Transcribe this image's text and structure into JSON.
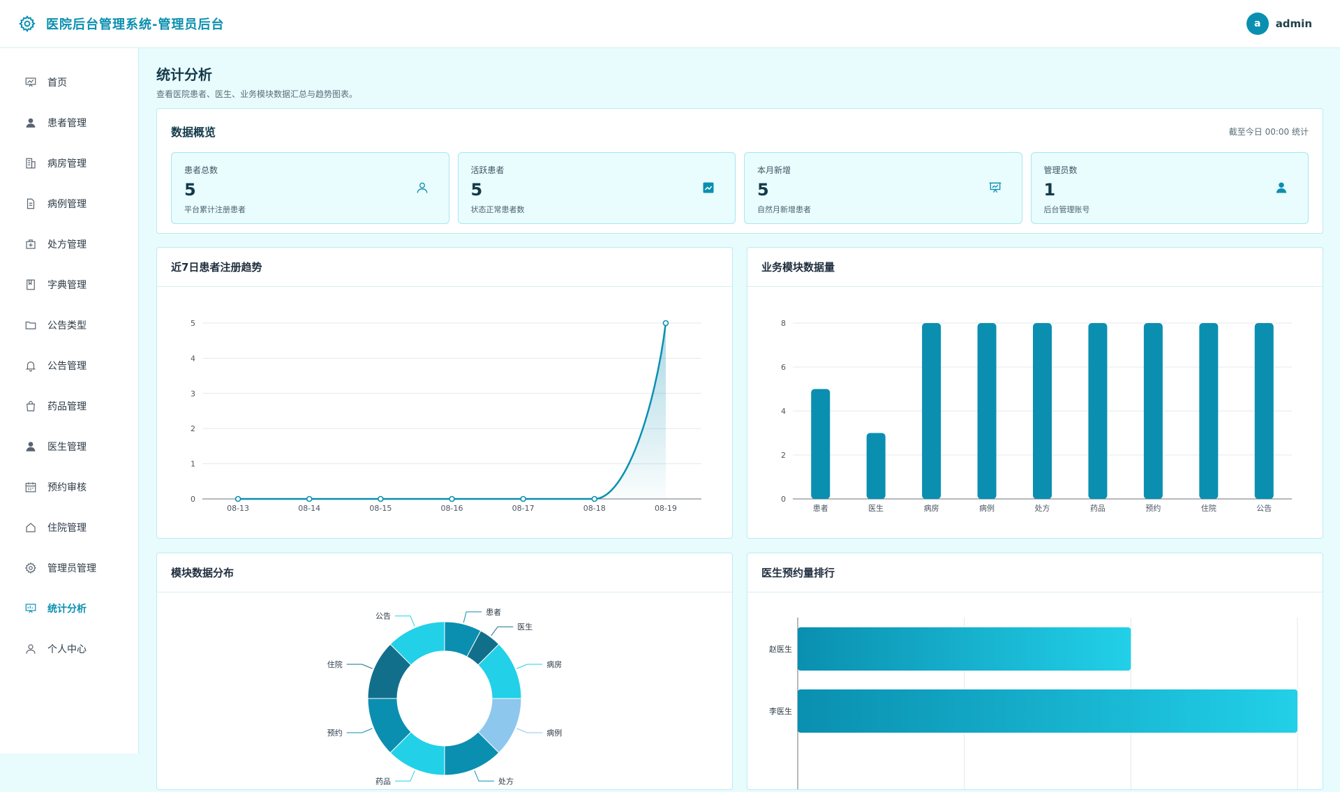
{
  "header": {
    "title": "医院后台管理系统-管理员后台",
    "avatar_letter": "a",
    "username": "admin"
  },
  "sidebar": {
    "items": [
      {
        "label": "首页",
        "icon": "chart-board-icon"
      },
      {
        "label": "患者管理",
        "icon": "user-icon"
      },
      {
        "label": "病房管理",
        "icon": "building-icon"
      },
      {
        "label": "病例管理",
        "icon": "document-icon"
      },
      {
        "label": "处方管理",
        "icon": "medical-kit-icon"
      },
      {
        "label": "字典管理",
        "icon": "book-icon"
      },
      {
        "label": "公告类型",
        "icon": "folder-icon"
      },
      {
        "label": "公告管理",
        "icon": "bell-icon"
      },
      {
        "label": "药品管理",
        "icon": "bag-icon"
      },
      {
        "label": "医生管理",
        "icon": "doctor-icon"
      },
      {
        "label": "预约审核",
        "icon": "calendar-icon"
      },
      {
        "label": "住院管理",
        "icon": "home-icon"
      },
      {
        "label": "管理员管理",
        "icon": "gear-icon"
      },
      {
        "label": "统计分析",
        "icon": "analytics-icon",
        "active": true
      },
      {
        "label": "个人中心",
        "icon": "person-icon"
      }
    ]
  },
  "page": {
    "title": "统计分析",
    "subtitle": "查看医院患者、医生、业务模块数据汇总与趋势图表。"
  },
  "overview": {
    "title": "数据概览",
    "note": "截至今日 00:00 统计",
    "stats": [
      {
        "label": "患者总数",
        "value": "5",
        "desc": "平台累计注册患者",
        "icon": "user-outline-icon"
      },
      {
        "label": "活跃患者",
        "value": "5",
        "desc": "状态正常患者数",
        "icon": "trend-icon"
      },
      {
        "label": "本月新增",
        "value": "5",
        "desc": "自然月新增患者",
        "icon": "presentation-icon"
      },
      {
        "label": "管理员数",
        "value": "1",
        "desc": "后台管理账号",
        "icon": "admin-user-icon"
      }
    ]
  },
  "panels": {
    "trend_title": "近7日患者注册趋势",
    "modules_title": "业务模块数据量",
    "distribution_title": "模块数据分布",
    "ranking_title": "医生预约量排行"
  },
  "colors": {
    "accent": "#0a8fb0",
    "light": "#22d0e8",
    "bg": "#e8fbfd"
  },
  "chart_data": [
    {
      "type": "line",
      "title": "近7日患者注册趋势",
      "x": [
        "08-13",
        "08-14",
        "08-15",
        "08-16",
        "08-17",
        "08-18",
        "08-19"
      ],
      "values": [
        0,
        0,
        0,
        0,
        0,
        0,
        5
      ],
      "ylim": [
        0,
        5
      ],
      "yticks": [
        0,
        1,
        2,
        3,
        4,
        5
      ],
      "grid": true
    },
    {
      "type": "bar",
      "title": "业务模块数据量",
      "categories": [
        "患者",
        "医生",
        "病房",
        "病例",
        "处方",
        "药品",
        "预约",
        "住院",
        "公告"
      ],
      "values": [
        5,
        3,
        8,
        8,
        8,
        8,
        8,
        8,
        8
      ],
      "ylim": [
        0,
        8
      ],
      "yticks": [
        0,
        2,
        4,
        6,
        8
      ],
      "grid": true
    },
    {
      "type": "pie",
      "title": "模块数据分布",
      "categories": [
        "患者",
        "医生",
        "病房",
        "病例",
        "处方",
        "药品",
        "预约",
        "住院",
        "公告"
      ],
      "values": [
        5,
        3,
        8,
        8,
        8,
        8,
        8,
        8,
        8
      ],
      "colors": [
        "#0a8fb0",
        "#126f8c",
        "#22d0e8",
        "#8ec7ee",
        "#0a8fb0",
        "#22d0e8",
        "#0a8fb0",
        "#126f8c",
        "#22d0e8"
      ]
    },
    {
      "type": "bar",
      "orientation": "horizontal",
      "title": "医生预约量排行",
      "categories": [
        "赵医生",
        "李医生"
      ],
      "values": [
        2,
        3
      ],
      "xlim": [
        0,
        3
      ]
    }
  ]
}
